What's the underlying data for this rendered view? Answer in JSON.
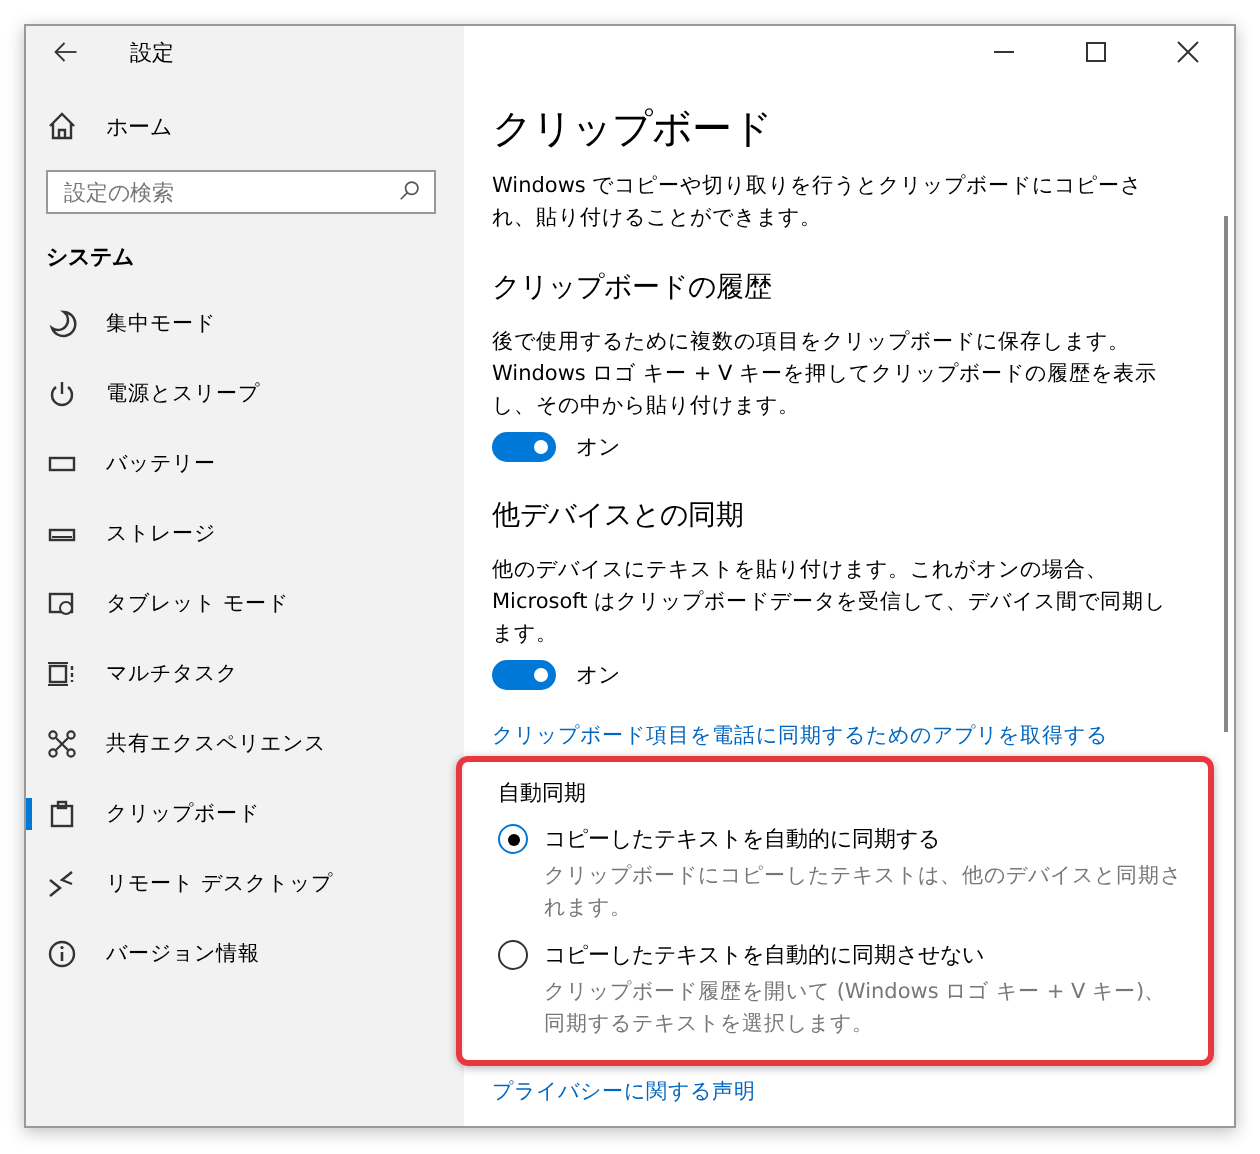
{
  "window": {
    "title": "設定"
  },
  "sidebar": {
    "home": "ホーム",
    "search": {
      "placeholder": "設定の検索"
    },
    "section": "システム",
    "items": [
      {
        "label": "集中モード",
        "selected": false
      },
      {
        "label": "電源とスリープ",
        "selected": false
      },
      {
        "label": "バッテリー",
        "selected": false
      },
      {
        "label": "ストレージ",
        "selected": false
      },
      {
        "label": "タブレット モード",
        "selected": false
      },
      {
        "label": "マルチタスク",
        "selected": false
      },
      {
        "label": "共有エクスペリエンス",
        "selected": false
      },
      {
        "label": "クリップボード",
        "selected": true
      },
      {
        "label": "リモート デスクトップ",
        "selected": false
      },
      {
        "label": "バージョン情報",
        "selected": false
      }
    ]
  },
  "content": {
    "title": "クリップボード",
    "intro": "Windows でコピーや切り取りを行うとクリップボードにコピーされ、貼り付けることができます。",
    "sections": [
      {
        "heading": "クリップボードの履歴",
        "description": "後で使用するために複数の項目をクリップボードに保存します。Windows ロゴ キー + V キーを押してクリップボードの履歴を表示し、その中から貼り付けます。",
        "toggle": {
          "on": true,
          "label": "オン"
        }
      },
      {
        "heading": "他デバイスとの同期",
        "description": "他のデバイスにテキストを貼り付けます。これがオンの場合、Microsoft はクリップボードデータを受信して、デバイス間で同期します。",
        "toggle": {
          "on": true,
          "label": "オン"
        }
      }
    ],
    "link": "クリップボード項目を電話に同期するためのアプリを取得する",
    "auto_sync": {
      "highlighted": true,
      "heading": "自動同期",
      "options": [
        {
          "label": "コピーしたテキストを自動的に同期する",
          "description": "クリップボードにコピーしたテキストは、他のデバイスと同期されます。",
          "selected": true
        },
        {
          "label": "コピーしたテキストを自動的に同期させない",
          "description": "クリップボード履歴を開いて (Windows ロゴ キー + V キー)、同期するテキストを選択します。",
          "selected": false
        }
      ]
    },
    "privacy_link": "プライバシーに関する声明"
  }
}
